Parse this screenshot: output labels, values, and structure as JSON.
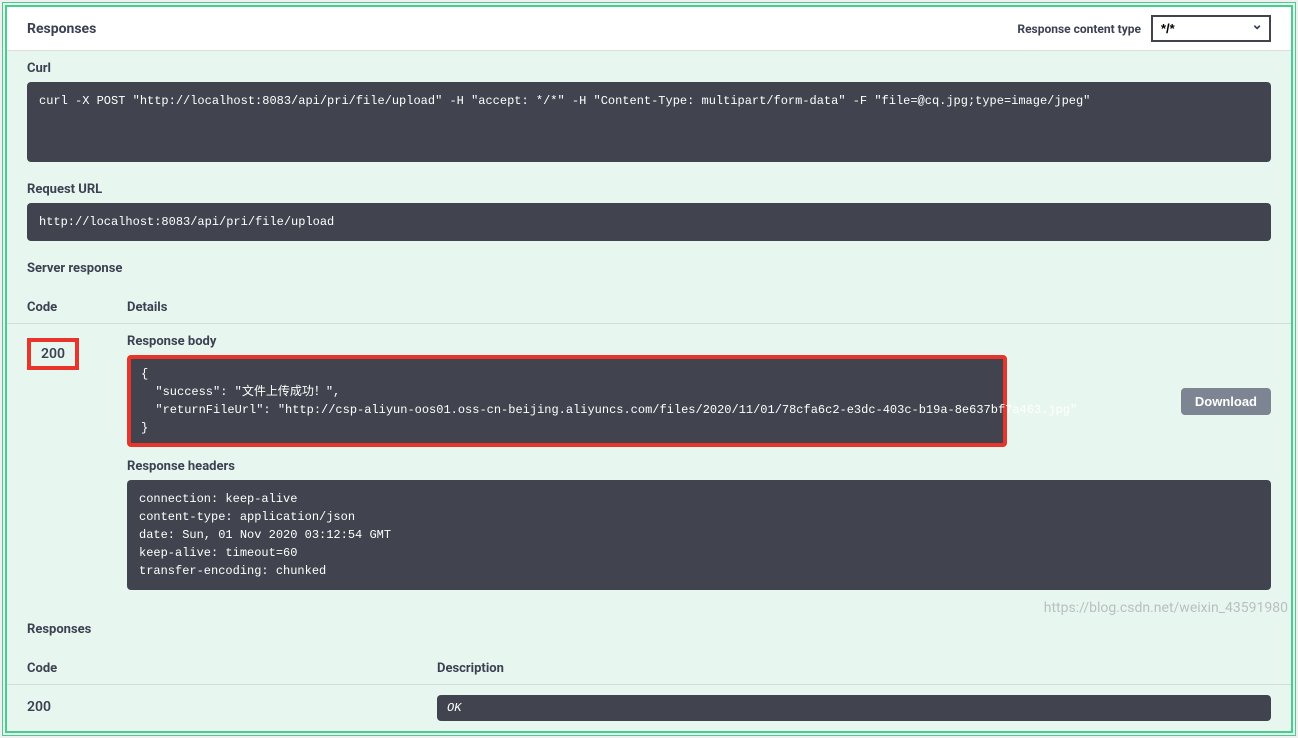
{
  "header": {
    "title": "Responses",
    "content_type_label": "Response content type",
    "content_type_value": "*/*"
  },
  "curl": {
    "label": "Curl",
    "command": "curl -X POST \"http://localhost:8083/api/pri/file/upload\" -H \"accept: */*\" -H \"Content-Type: multipart/form-data\" -F \"file=@cq.jpg;type=image/jpeg\""
  },
  "request_url": {
    "label": "Request URL",
    "value": "http://localhost:8083/api/pri/file/upload"
  },
  "server_response": {
    "label": "Server response",
    "code_header": "Code",
    "details_header": "Details",
    "code": "200",
    "response_body_label": "Response body",
    "response_body": "{\n  \"success\": \"文件上传成功！\",\n  \"returnFileUrl\": \"http://csp-aliyun-oos01.oss-cn-beijing.aliyuncs.com/files/2020/11/01/78cfa6c2-e3dc-403c-b19a-8e637bf7a463.jpg\"\n}",
    "download_label": "Download",
    "response_headers_label": "Response headers",
    "response_headers": "connection: keep-alive\ncontent-type: application/json\ndate: Sun, 01 Nov 2020 03:12:54 GMT\nkeep-alive: timeout=60\ntransfer-encoding: chunked"
  },
  "responses_table": {
    "label": "Responses",
    "code_header": "Code",
    "description_header": "Description",
    "rows": [
      {
        "code": "200",
        "description": "OK"
      }
    ]
  },
  "watermark": "https://blog.csdn.net/weixin_43591980"
}
